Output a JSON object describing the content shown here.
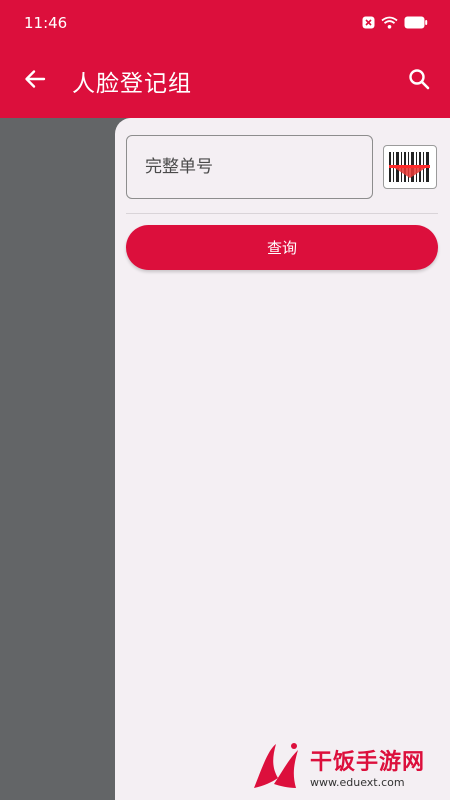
{
  "status": {
    "time": "11:46"
  },
  "appbar": {
    "title": "人脸登记组"
  },
  "form": {
    "order_placeholder": "完整单号",
    "query_label": "查询"
  },
  "watermark": {
    "name": "干饭手游网",
    "url": "www.eduext.com"
  },
  "colors": {
    "primary": "#dc0f3c",
    "scrim": "#636567",
    "drawer_bg": "#f4eff3"
  },
  "icons": {
    "back": "arrow-left-icon",
    "search": "search-icon",
    "scan": "barcode-scan-icon",
    "wifi": "wifi-icon",
    "battery": "battery-icon",
    "notification": "notification-icon"
  }
}
